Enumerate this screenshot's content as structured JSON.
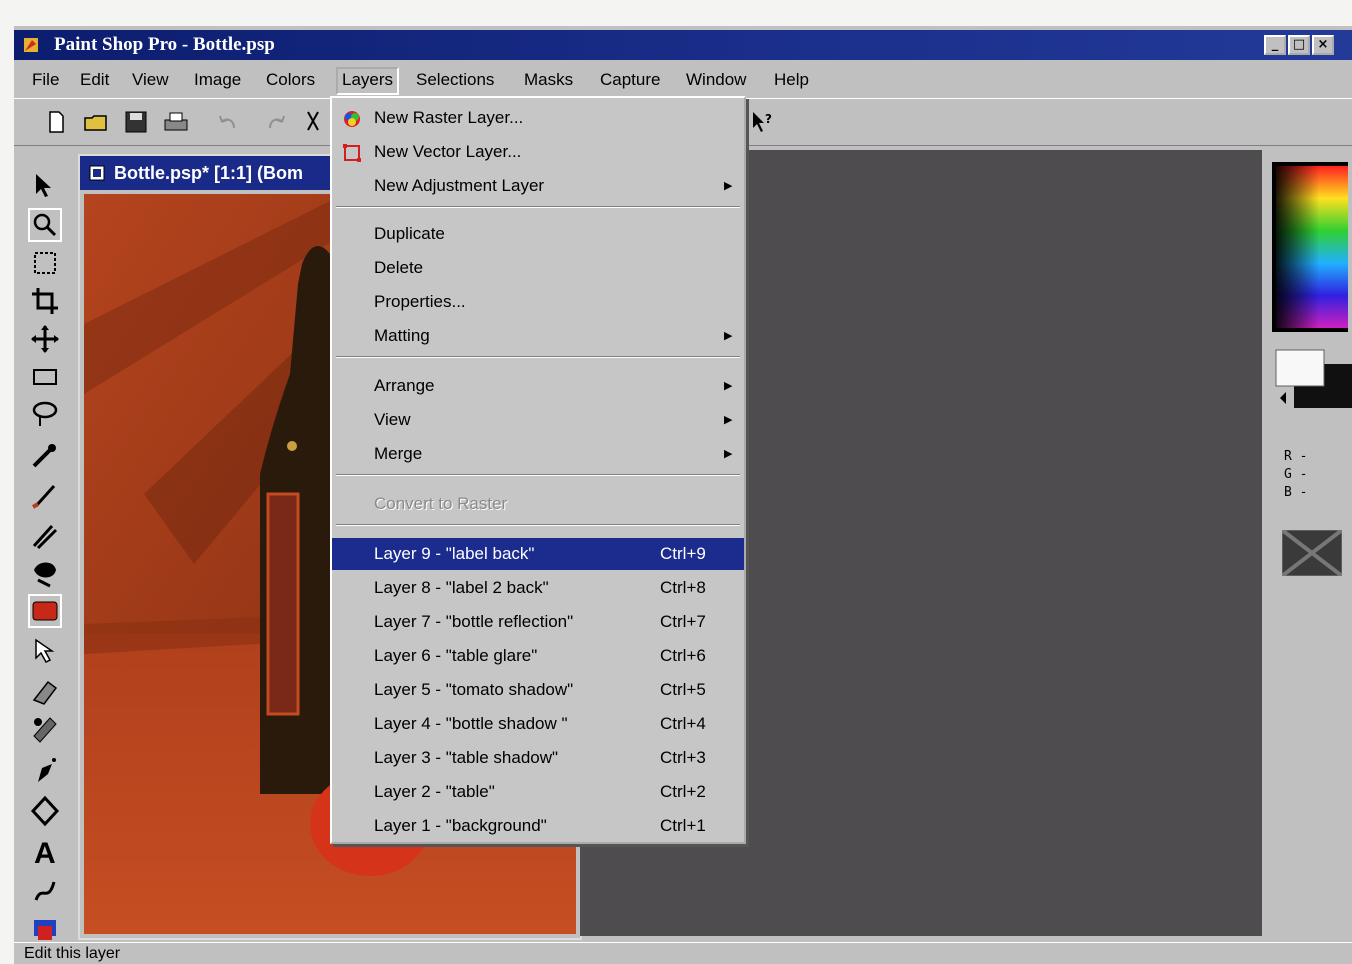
{
  "window": {
    "title": "Paint Shop Pro - Bottle.psp",
    "controls": [
      "_",
      "□",
      "×"
    ]
  },
  "menubar": {
    "items": [
      "File",
      "Edit",
      "View",
      "Image",
      "Colors",
      "Layers",
      "Selections",
      "Masks",
      "Capture",
      "Window",
      "Help"
    ],
    "active": "Layers"
  },
  "document": {
    "title": "Bottle.psp* [1:1] (Bom"
  },
  "layers_menu": {
    "new_raster": "New Raster Layer...",
    "new_vector": "New Vector Layer...",
    "new_adjustment": "New Adjustment Layer",
    "duplicate": "Duplicate",
    "delete": "Delete",
    "properties": "Properties...",
    "matting": "Matting",
    "arrange": "Arrange",
    "view": "View",
    "merge": "Merge",
    "convert": "Convert to Raster",
    "layers": [
      {
        "label": "Layer 9 - \"label back\"",
        "shortcut": "Ctrl+9"
      },
      {
        "label": "Layer 8 - \"label 2 back\"",
        "shortcut": "Ctrl+8"
      },
      {
        "label": "Layer 7 - \"bottle reflection\"",
        "shortcut": "Ctrl+7"
      },
      {
        "label": "Layer 6 - \"table glare\"",
        "shortcut": "Ctrl+6"
      },
      {
        "label": "Layer 5 - \"tomato shadow\"",
        "shortcut": "Ctrl+5"
      },
      {
        "label": "Layer 4 - \"bottle shadow \"",
        "shortcut": "Ctrl+4"
      },
      {
        "label": "Layer 3 - \"table shadow\"",
        "shortcut": "Ctrl+3"
      },
      {
        "label": "Layer 2 - \"table\"",
        "shortcut": "Ctrl+2"
      },
      {
        "label": "Layer 1 - \"background\"",
        "shortcut": "Ctrl+1"
      }
    ]
  },
  "color_panel": {
    "r": "R -",
    "g": "G -",
    "b": "B -"
  },
  "status": {
    "text": "Edit this layer"
  },
  "colors": {
    "titlebar": "#1b2f8c",
    "highlight": "#1b2c8e",
    "canvas_bg": "#4e4c4e"
  }
}
